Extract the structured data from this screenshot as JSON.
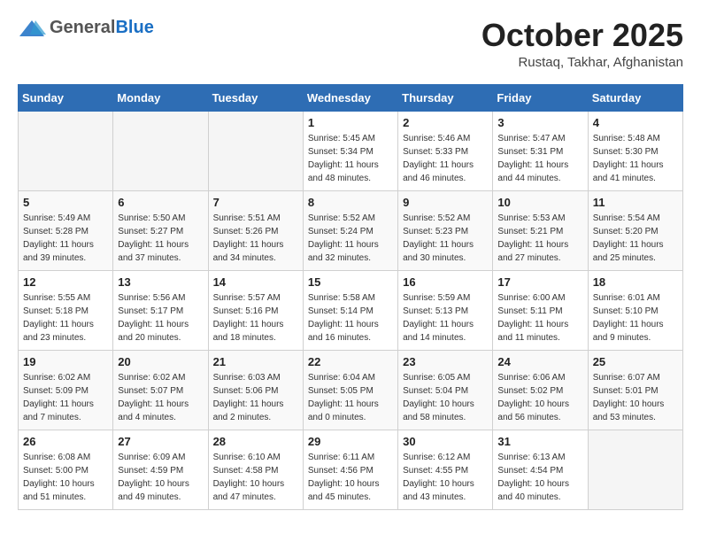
{
  "header": {
    "logo_general": "General",
    "logo_blue": "Blue",
    "month_year": "October 2025",
    "location": "Rustaq, Takhar, Afghanistan"
  },
  "weekdays": [
    "Sunday",
    "Monday",
    "Tuesday",
    "Wednesday",
    "Thursday",
    "Friday",
    "Saturday"
  ],
  "weeks": [
    [
      {
        "day": "",
        "info": ""
      },
      {
        "day": "",
        "info": ""
      },
      {
        "day": "",
        "info": ""
      },
      {
        "day": "1",
        "info": "Sunrise: 5:45 AM\nSunset: 5:34 PM\nDaylight: 11 hours\nand 48 minutes."
      },
      {
        "day": "2",
        "info": "Sunrise: 5:46 AM\nSunset: 5:33 PM\nDaylight: 11 hours\nand 46 minutes."
      },
      {
        "day": "3",
        "info": "Sunrise: 5:47 AM\nSunset: 5:31 PM\nDaylight: 11 hours\nand 44 minutes."
      },
      {
        "day": "4",
        "info": "Sunrise: 5:48 AM\nSunset: 5:30 PM\nDaylight: 11 hours\nand 41 minutes."
      }
    ],
    [
      {
        "day": "5",
        "info": "Sunrise: 5:49 AM\nSunset: 5:28 PM\nDaylight: 11 hours\nand 39 minutes."
      },
      {
        "day": "6",
        "info": "Sunrise: 5:50 AM\nSunset: 5:27 PM\nDaylight: 11 hours\nand 37 minutes."
      },
      {
        "day": "7",
        "info": "Sunrise: 5:51 AM\nSunset: 5:26 PM\nDaylight: 11 hours\nand 34 minutes."
      },
      {
        "day": "8",
        "info": "Sunrise: 5:52 AM\nSunset: 5:24 PM\nDaylight: 11 hours\nand 32 minutes."
      },
      {
        "day": "9",
        "info": "Sunrise: 5:52 AM\nSunset: 5:23 PM\nDaylight: 11 hours\nand 30 minutes."
      },
      {
        "day": "10",
        "info": "Sunrise: 5:53 AM\nSunset: 5:21 PM\nDaylight: 11 hours\nand 27 minutes."
      },
      {
        "day": "11",
        "info": "Sunrise: 5:54 AM\nSunset: 5:20 PM\nDaylight: 11 hours\nand 25 minutes."
      }
    ],
    [
      {
        "day": "12",
        "info": "Sunrise: 5:55 AM\nSunset: 5:18 PM\nDaylight: 11 hours\nand 23 minutes."
      },
      {
        "day": "13",
        "info": "Sunrise: 5:56 AM\nSunset: 5:17 PM\nDaylight: 11 hours\nand 20 minutes."
      },
      {
        "day": "14",
        "info": "Sunrise: 5:57 AM\nSunset: 5:16 PM\nDaylight: 11 hours\nand 18 minutes."
      },
      {
        "day": "15",
        "info": "Sunrise: 5:58 AM\nSunset: 5:14 PM\nDaylight: 11 hours\nand 16 minutes."
      },
      {
        "day": "16",
        "info": "Sunrise: 5:59 AM\nSunset: 5:13 PM\nDaylight: 11 hours\nand 14 minutes."
      },
      {
        "day": "17",
        "info": "Sunrise: 6:00 AM\nSunset: 5:11 PM\nDaylight: 11 hours\nand 11 minutes."
      },
      {
        "day": "18",
        "info": "Sunrise: 6:01 AM\nSunset: 5:10 PM\nDaylight: 11 hours\nand 9 minutes."
      }
    ],
    [
      {
        "day": "19",
        "info": "Sunrise: 6:02 AM\nSunset: 5:09 PM\nDaylight: 11 hours\nand 7 minutes."
      },
      {
        "day": "20",
        "info": "Sunrise: 6:02 AM\nSunset: 5:07 PM\nDaylight: 11 hours\nand 4 minutes."
      },
      {
        "day": "21",
        "info": "Sunrise: 6:03 AM\nSunset: 5:06 PM\nDaylight: 11 hours\nand 2 minutes."
      },
      {
        "day": "22",
        "info": "Sunrise: 6:04 AM\nSunset: 5:05 PM\nDaylight: 11 hours\nand 0 minutes."
      },
      {
        "day": "23",
        "info": "Sunrise: 6:05 AM\nSunset: 5:04 PM\nDaylight: 10 hours\nand 58 minutes."
      },
      {
        "day": "24",
        "info": "Sunrise: 6:06 AM\nSunset: 5:02 PM\nDaylight: 10 hours\nand 56 minutes."
      },
      {
        "day": "25",
        "info": "Sunrise: 6:07 AM\nSunset: 5:01 PM\nDaylight: 10 hours\nand 53 minutes."
      }
    ],
    [
      {
        "day": "26",
        "info": "Sunrise: 6:08 AM\nSunset: 5:00 PM\nDaylight: 10 hours\nand 51 minutes."
      },
      {
        "day": "27",
        "info": "Sunrise: 6:09 AM\nSunset: 4:59 PM\nDaylight: 10 hours\nand 49 minutes."
      },
      {
        "day": "28",
        "info": "Sunrise: 6:10 AM\nSunset: 4:58 PM\nDaylight: 10 hours\nand 47 minutes."
      },
      {
        "day": "29",
        "info": "Sunrise: 6:11 AM\nSunset: 4:56 PM\nDaylight: 10 hours\nand 45 minutes."
      },
      {
        "day": "30",
        "info": "Sunrise: 6:12 AM\nSunset: 4:55 PM\nDaylight: 10 hours\nand 43 minutes."
      },
      {
        "day": "31",
        "info": "Sunrise: 6:13 AM\nSunset: 4:54 PM\nDaylight: 10 hours\nand 40 minutes."
      },
      {
        "day": "",
        "info": ""
      }
    ]
  ]
}
